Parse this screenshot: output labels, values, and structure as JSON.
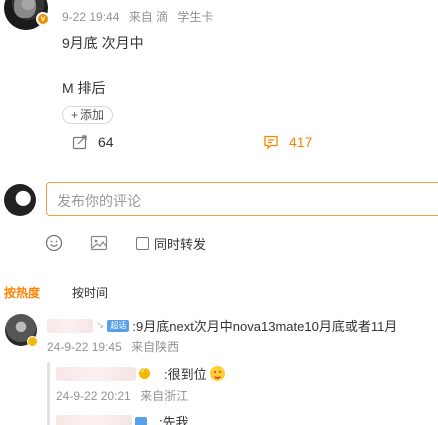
{
  "post": {
    "time": "9-22 19:44",
    "source": "来自 滴",
    "tag": "学生卡",
    "lines": [
      "9月底  次月中",
      "M 排后"
    ],
    "add_label": "添加",
    "reposts": "64",
    "comments": "417",
    "comment_color": "#ff8200"
  },
  "composer": {
    "placeholder": "发布你的评论",
    "sync_repost_label": "同时转发",
    "icons": [
      "emoji-icon",
      "image-icon"
    ]
  },
  "sort_tabs": [
    {
      "label": "按热度",
      "active": true
    },
    {
      "label": "按时间",
      "active": false
    }
  ],
  "comments": [
    {
      "badge_text": "超话",
      "text": ":9月底next次月中nova13mate10月底或者11月",
      "time": "24-9-22 19:45",
      "location": "来自陕西",
      "replies": [
        {
          "text": ":很到位",
          "time": "24-9-22 20:21",
          "location": "来自浙江"
        },
        {
          "text": ":先我"
        }
      ]
    }
  ]
}
